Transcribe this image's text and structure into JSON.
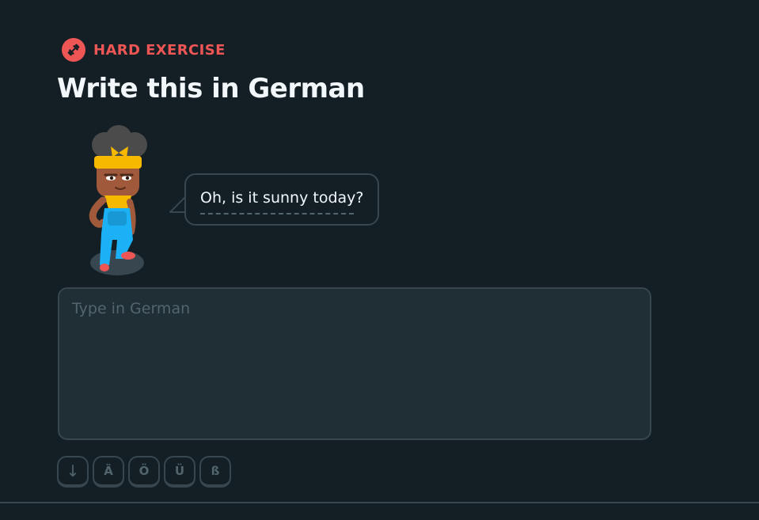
{
  "exercise": {
    "badge_icon": "dumbbell-icon",
    "badge_label": "HARD EXERCISE",
    "badge_color": "#ee5555",
    "title": "Write this in German"
  },
  "prompt": {
    "character": "character-illustration",
    "sentence": "Oh, is it sunny today?"
  },
  "answer": {
    "value": "",
    "placeholder": "Type in German"
  },
  "keyboard": {
    "keys": [
      "↓",
      "Ä",
      "Ö",
      "Ü",
      "ß"
    ]
  },
  "colors": {
    "background": "#131f24",
    "input_background": "#202f36",
    "border": "#37464f",
    "text": "#f1f7fb",
    "muted": "#52656d"
  }
}
